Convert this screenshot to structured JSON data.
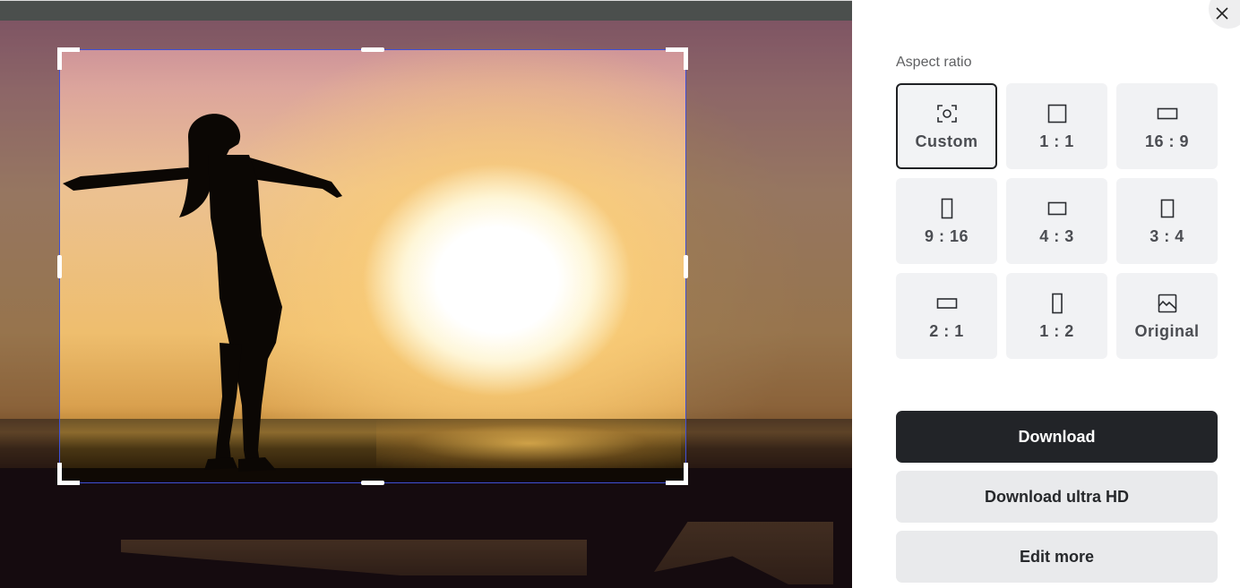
{
  "panel": {
    "close_label": "Close",
    "section_label": "Aspect ratio",
    "selected_ratio": "Custom",
    "ratios": [
      {
        "label": "Custom",
        "icon": "focus-frame-icon",
        "selected": true
      },
      {
        "label": "1 : 1",
        "icon": "square-icon",
        "selected": false
      },
      {
        "label": "16 : 9",
        "icon": "landscape-wide-icon",
        "selected": false
      },
      {
        "label": "9 : 16",
        "icon": "portrait-tall-icon",
        "selected": false
      },
      {
        "label": "4 : 3",
        "icon": "landscape-icon",
        "selected": false
      },
      {
        "label": "3 : 4",
        "icon": "portrait-icon",
        "selected": false
      },
      {
        "label": "2 : 1",
        "icon": "landscape-wide-icon",
        "selected": false
      },
      {
        "label": "1 : 2",
        "icon": "portrait-tall-icon",
        "selected": false
      },
      {
        "label": "Original",
        "icon": "image-icon",
        "selected": false
      }
    ],
    "buttons": {
      "download": "Download",
      "download_hd": "Download ultra HD",
      "edit_more": "Edit more"
    }
  },
  "editor": {
    "image_subject": "Silhouette of woman with outstretched arms at sunset on a pier",
    "crop_mode": "Custom"
  },
  "colors": {
    "primary_button": "#222428",
    "secondary_button": "#e9eaec",
    "tile_bg": "#f1f2f4",
    "crop_border": "#3f4fd6"
  }
}
